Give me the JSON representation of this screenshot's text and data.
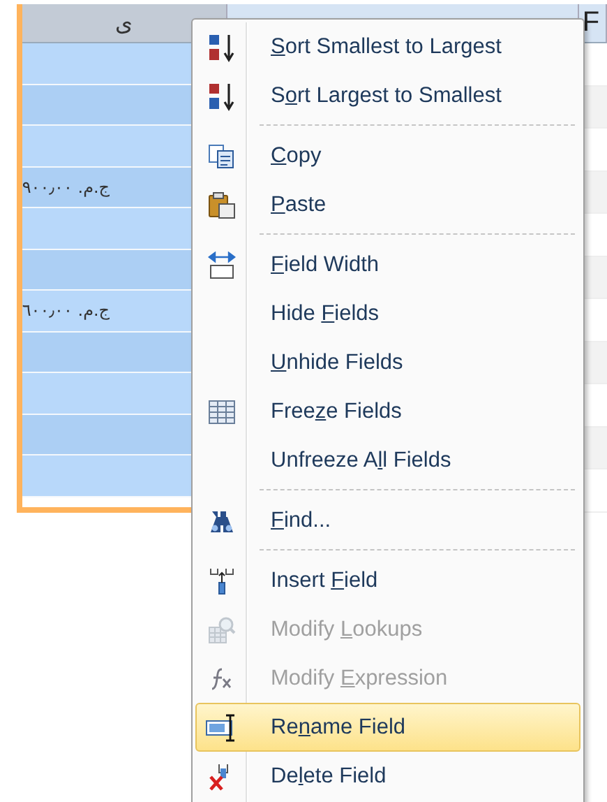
{
  "table": {
    "columns": [
      {
        "header": "ى",
        "selected": true
      },
      {
        "header": "F",
        "selected": false
      }
    ],
    "rows": [
      {},
      {},
      {},
      {
        "amount": "ج.م. ٩٠٠٫٠٠"
      },
      {},
      {},
      {
        "amount": "ج.م. ٦٠٠٫٠٠"
      },
      {},
      {},
      {},
      {}
    ]
  },
  "context_menu": {
    "items": [
      {
        "kind": "item",
        "label": "Sort Smallest to Largest",
        "disabled": false,
        "selected": false
      },
      {
        "kind": "item",
        "label": "Sort Largest to Smallest",
        "disabled": false,
        "selected": false
      },
      {
        "kind": "separator"
      },
      {
        "kind": "item",
        "label": "Copy",
        "disabled": false,
        "selected": false
      },
      {
        "kind": "item",
        "label": "Paste",
        "disabled": false,
        "selected": false
      },
      {
        "kind": "separator"
      },
      {
        "kind": "item",
        "label": "Field Width",
        "disabled": false,
        "selected": false
      },
      {
        "kind": "item",
        "label": "Hide Fields",
        "disabled": false,
        "selected": false
      },
      {
        "kind": "item",
        "label": "Unhide Fields",
        "disabled": false,
        "selected": false
      },
      {
        "kind": "item",
        "label": "Freeze Fields",
        "disabled": false,
        "selected": false
      },
      {
        "kind": "item",
        "label": "Unfreeze All Fields",
        "disabled": false,
        "selected": false
      },
      {
        "kind": "separator"
      },
      {
        "kind": "item",
        "label": "Find...",
        "disabled": false,
        "selected": false
      },
      {
        "kind": "separator"
      },
      {
        "kind": "item",
        "label": "Insert Field",
        "disabled": false,
        "selected": false
      },
      {
        "kind": "item",
        "label": "Modify Lookups",
        "disabled": true,
        "selected": false
      },
      {
        "kind": "item",
        "label": "Modify Expression",
        "disabled": true,
        "selected": false
      },
      {
        "kind": "item",
        "label": "Rename Field",
        "disabled": false,
        "selected": true
      },
      {
        "kind": "item",
        "label": "Delete Field",
        "disabled": false,
        "selected": false
      }
    ]
  }
}
